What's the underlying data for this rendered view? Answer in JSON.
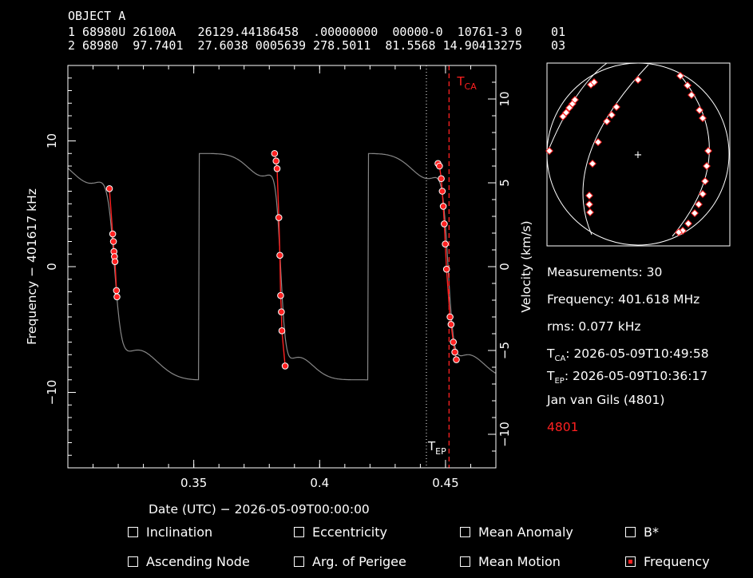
{
  "header": {
    "object_name": "OBJECT A",
    "tle_line1": "1 68980U 26100A   26129.44186458  .00000000  00000-0  10761-3 0    01",
    "tle_line2": "2 68980  97.7401  27.6038 0005639 278.5011  81.5568 14.90413275    03"
  },
  "colors": {
    "background": "#000000",
    "foreground": "#ffffff",
    "accent": "#ff2020",
    "model_curve": "#888888"
  },
  "chart_data": {
    "type": "scatter",
    "xlabel": "Date (UTC) − 2026-05-09T00:00:00",
    "ylabel": "Frequency − 401617 kHz",
    "y2label": "Velocity (km/s)",
    "xlim": [
      0.3,
      0.47
    ],
    "ylim": [
      -16,
      16
    ],
    "y2lim": [
      -12,
      12
    ],
    "x_ticks": [
      0.35,
      0.4,
      0.45
    ],
    "x_tick_labels": [
      "0.35",
      "0.4",
      "0.45"
    ],
    "y_ticks": [
      -10,
      0,
      10
    ],
    "y_tick_labels": [
      "−10",
      "0",
      "10"
    ],
    "y2_ticks": [
      -10,
      -5,
      0,
      5,
      10
    ],
    "y2_tick_labels": [
      "−10",
      "−5",
      "0",
      "5",
      "10"
    ],
    "tca": {
      "x": 0.4514,
      "label_main": "T",
      "label_sub": "CA"
    },
    "tep": {
      "x": 0.4424,
      "label_main": "T",
      "label_sub": "EP"
    },
    "measurements": [
      [
        0.3165,
        6.2
      ],
      [
        0.3178,
        2.6
      ],
      [
        0.3181,
        2.0
      ],
      [
        0.3183,
        1.2
      ],
      [
        0.3185,
        0.8
      ],
      [
        0.3187,
        0.4
      ],
      [
        0.3193,
        -1.9
      ],
      [
        0.3195,
        -2.4
      ],
      [
        0.3821,
        9.0
      ],
      [
        0.3827,
        8.4
      ],
      [
        0.3831,
        7.8
      ],
      [
        0.3838,
        3.9
      ],
      [
        0.3842,
        0.9
      ],
      [
        0.3845,
        -2.3
      ],
      [
        0.3848,
        -3.6
      ],
      [
        0.385,
        -5.1
      ],
      [
        0.3863,
        -7.9
      ],
      [
        0.447,
        8.2
      ],
      [
        0.4476,
        8.0
      ],
      [
        0.4483,
        7.0
      ],
      [
        0.4487,
        6.0
      ],
      [
        0.4491,
        4.8
      ],
      [
        0.4495,
        3.4
      ],
      [
        0.4499,
        1.8
      ],
      [
        0.4504,
        -0.2
      ],
      [
        0.4518,
        -4.0
      ],
      [
        0.4522,
        -4.6
      ],
      [
        0.4531,
        -6.0
      ],
      [
        0.4537,
        -6.8
      ],
      [
        0.4543,
        -7.4
      ]
    ]
  },
  "sky_plot": {
    "center_mark": "+"
  },
  "info": {
    "measurements": "Measurements: 30",
    "frequency": "Frequency: 401.618 MHz",
    "rms": "rms: 0.077 kHz",
    "tca_main": "T",
    "tca_sub": "CA",
    "tca_value": ": 2026-05-09T10:49:58",
    "tep_main": "T",
    "tep_sub": "EP",
    "tep_value": ": 2026-05-09T10:36:17",
    "observer": "Jan van Gils (4801)",
    "station_id": "4801"
  },
  "controls": {
    "inclination": {
      "label": "Inclination",
      "checked": false
    },
    "eccentricity": {
      "label": "Eccentricity",
      "checked": false
    },
    "mean_anomaly": {
      "label": "Mean Anomaly",
      "checked": false
    },
    "bstar": {
      "label": "B*",
      "checked": false
    },
    "ascending_node": {
      "label": "Ascending Node",
      "checked": false
    },
    "arg_perigee": {
      "label": "Arg. of Perigee",
      "checked": false
    },
    "mean_motion": {
      "label": "Mean Motion",
      "checked": false
    },
    "frequency": {
      "label": "Frequency",
      "checked": true
    }
  }
}
